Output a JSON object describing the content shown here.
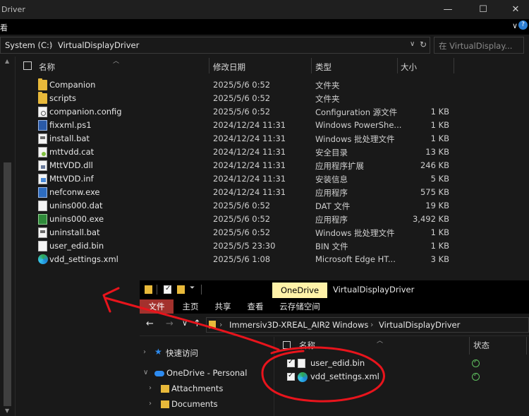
{
  "back_window": {
    "title": "Driver",
    "controls": {
      "minimize": "—",
      "maximize": "☐",
      "close": "✕"
    },
    "menu_glyph": "看",
    "address": {
      "crumbs": [
        "System (C:)",
        "VirtualDisplayDriver"
      ],
      "search_placeholder": "在 VirtualDisplay..."
    },
    "columns": {
      "name": "名称",
      "date": "修改日期",
      "type": "类型",
      "size": "大小"
    },
    "files": [
      {
        "name": "Companion",
        "date": "2025/5/6 0:52",
        "type": "文件夹",
        "size": "",
        "icon": "folder-icon"
      },
      {
        "name": "scripts",
        "date": "2025/5/6 0:52",
        "type": "文件夹",
        "size": "",
        "icon": "folder-icon"
      },
      {
        "name": "companion.config",
        "date": "2025/5/6 0:52",
        "type": "Configuration 源文件",
        "size": "1 KB",
        "icon": "config-file-icon"
      },
      {
        "name": "fixxml.ps1",
        "date": "2024/12/24 11:31",
        "type": "Windows PowerShe...",
        "size": "1 KB",
        "icon": "powershell-file-icon"
      },
      {
        "name": "install.bat",
        "date": "2024/12/24 11:31",
        "type": "Windows 批处理文件",
        "size": "1 KB",
        "icon": "batch-file-icon"
      },
      {
        "name": "mttvdd.cat",
        "date": "2024/12/24 11:31",
        "type": "安全目录",
        "size": "13 KB",
        "icon": "catalog-file-icon"
      },
      {
        "name": "MttVDD.dll",
        "date": "2024/12/24 11:31",
        "type": "应用程序扩展",
        "size": "246 KB",
        "icon": "dll-file-icon"
      },
      {
        "name": "MttVDD.inf",
        "date": "2024/12/24 11:31",
        "type": "安装信息",
        "size": "5 KB",
        "icon": "inf-file-icon"
      },
      {
        "name": "nefconw.exe",
        "date": "2024/12/24 11:31",
        "type": "应用程序",
        "size": "575 KB",
        "icon": "exe-file-icon"
      },
      {
        "name": "unins000.dat",
        "date": "2025/5/6 0:52",
        "type": "DAT 文件",
        "size": "19 KB",
        "icon": "file-icon"
      },
      {
        "name": "unins000.exe",
        "date": "2025/5/6 0:52",
        "type": "应用程序",
        "size": "3,492 KB",
        "icon": "installer-exe-icon"
      },
      {
        "name": "uninstall.bat",
        "date": "2025/5/6 0:52",
        "type": "Windows 批处理文件",
        "size": "1 KB",
        "icon": "batch-file-icon"
      },
      {
        "name": "user_edid.bin",
        "date": "2025/5/5 23:30",
        "type": "BIN 文件",
        "size": "1 KB",
        "icon": "file-icon"
      },
      {
        "name": "vdd_settings.xml",
        "date": "2025/5/6 1:08",
        "type": "Microsoft Edge HT...",
        "size": "3 KB",
        "icon": "edge-file-icon"
      }
    ]
  },
  "front_window": {
    "context_tab": "OneDrive",
    "title": "VirtualDisplayDriver",
    "ribbon_tabs": [
      "文件",
      "主页",
      "共享",
      "查看",
      "云存储空间"
    ],
    "nav_buttons": {
      "back": "←",
      "forward": "→",
      "recent": "∨",
      "up": "↑"
    },
    "crumbs": [
      "Immersiv3D-XREAL_AIR2",
      "Windows",
      "VirtualDisplayDriver"
    ],
    "nav_items": [
      {
        "label": "快速访问",
        "icon": "star-icon"
      },
      {
        "label": "OneDrive - Personal",
        "icon": "onedrive-cloud-icon"
      },
      {
        "label": "Attachments",
        "icon": "folder-icon"
      },
      {
        "label": "Documents",
        "icon": "folder-icon"
      }
    ],
    "columns": {
      "name": "名称",
      "status": "状态"
    },
    "files": [
      {
        "name": "user_edid.bin",
        "icon": "file-icon"
      },
      {
        "name": "vdd_settings.xml",
        "icon": "edge-file-icon"
      }
    ]
  },
  "annotation": {
    "color": "#e8141c"
  }
}
